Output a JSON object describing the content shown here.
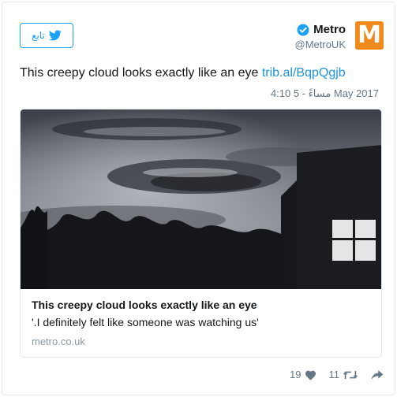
{
  "header": {
    "author_name": "Metro",
    "author_handle": "@MetroUK",
    "logo_letter": "M",
    "follow_label": "تابع"
  },
  "tweet": {
    "text": "This creepy cloud looks exactly like an eye",
    "link": "trib.al/BqpQgjb",
    "timestamp": "4:10 مساءً - 5 May 2017"
  },
  "card": {
    "title": "This creepy cloud looks exactly like an eye",
    "description": "'.I definitely felt like someone was watching us'",
    "domain": "metro.co.uk"
  },
  "actions": {
    "likes": "19",
    "retweets": "11"
  },
  "icons": {
    "logo": "metro-logo-icon",
    "verified": "verified-badge-icon",
    "follow": "twitter-bird-icon",
    "like": "heart-icon",
    "retweet": "retweet-icon",
    "share": "share-icon"
  },
  "colors": {
    "brand_blue": "#1da1f2",
    "link_blue": "#1b95e0",
    "metro_orange": "#f08a1c",
    "muted_text": "#657786"
  }
}
